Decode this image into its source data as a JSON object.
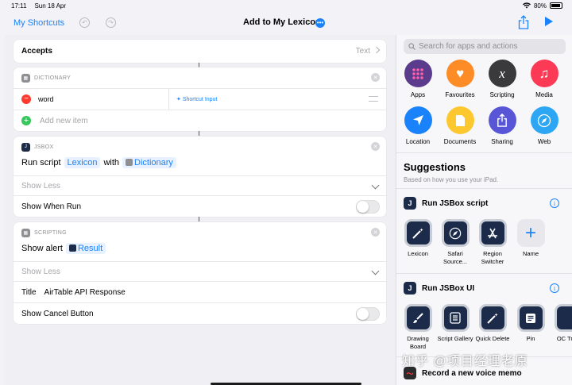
{
  "status": {
    "time": "17:11",
    "date": "Sun 18 Apr",
    "battery": "80%",
    "battery_level": 0.8,
    "wifi_icon": "wifi-icon"
  },
  "nav": {
    "back_label": "My Shortcuts",
    "title": "Add to My Lexicon",
    "more_glyph": "•••",
    "accent": "#1a82fb"
  },
  "accepts": {
    "label": "Accepts",
    "value": "Text"
  },
  "dictionary": {
    "header": "DICTIONARY",
    "item_key": "word",
    "item_value": "Shortcut Input",
    "add_placeholder": "Add new item"
  },
  "jsbox": {
    "header": "JSBOX",
    "run_script": "Run script",
    "script_token": "Lexicon",
    "with_word": "with",
    "dict_token": "Dictionary",
    "show_less": "Show Less",
    "show_when_run": "Show When Run"
  },
  "scripting": {
    "header": "SCRIPTING",
    "show_alert": "Show alert",
    "result_token": "Result",
    "show_less": "Show Less",
    "title_label": "Title",
    "title_value": "AirTable API Response",
    "show_cancel": "Show Cancel Button"
  },
  "sidebar": {
    "search_placeholder": "Search for apps and actions",
    "categories": [
      {
        "label": "Apps",
        "color": "#5a3b8c",
        "icon": "apps-grid-icon"
      },
      {
        "label": "Favourites",
        "color": "#fe8c26",
        "icon": "heart-icon"
      },
      {
        "label": "Scripting",
        "color": "#3a3a3c",
        "icon": "scripting-x-icon"
      },
      {
        "label": "Media",
        "color": "#fd3a55",
        "icon": "music-note-icon"
      },
      {
        "label": "Location",
        "color": "#1a82fb",
        "icon": "location-arrow-icon"
      },
      {
        "label": "Documents",
        "color": "#fdc82f",
        "icon": "document-icon"
      },
      {
        "label": "Sharing",
        "color": "#5856d6",
        "icon": "share-icon"
      },
      {
        "label": "Web",
        "color": "#2da7f4",
        "icon": "compass-icon"
      }
    ],
    "suggestions_title": "Suggestions",
    "suggestions_sub": "Based on how you use your iPad.",
    "groups": [
      {
        "title": "Run JSBox script",
        "tiles": [
          {
            "label": "Lexicon",
            "icon": "magic-wand-icon"
          },
          {
            "label": "Safari Source...",
            "icon": "compass-icon"
          },
          {
            "label": "Region Switcher",
            "icon": "app-store-icon"
          },
          {
            "label": "Name",
            "icon": "plus-icon"
          }
        ]
      },
      {
        "title": "Run JSBox UI",
        "tiles": [
          {
            "label": "Drawing Board",
            "icon": "brush-icon"
          },
          {
            "label": "Script Gallery",
            "icon": "list-icon"
          },
          {
            "label": "Quick Delete",
            "icon": "magic-wand-icon"
          },
          {
            "label": "Pin",
            "icon": "note-icon"
          },
          {
            "label": "OC Tran",
            "icon": "tile-icon"
          }
        ]
      }
    ],
    "next_group": "Record a new voice memo",
    "watermark": "知乎 @项目经理老原"
  }
}
